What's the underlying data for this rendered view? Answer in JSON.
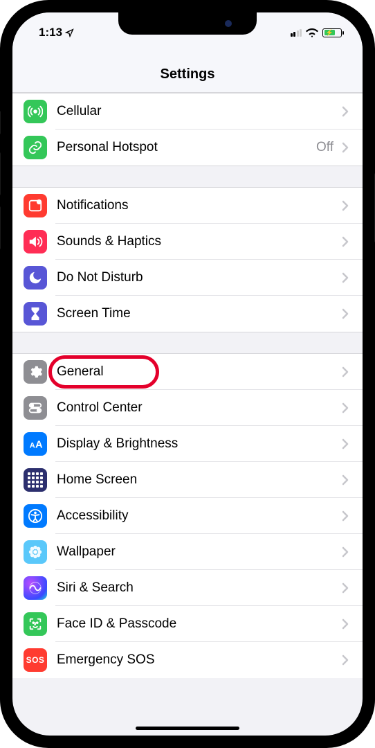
{
  "statusbar": {
    "time": "1:13"
  },
  "header": {
    "title": "Settings"
  },
  "groups": [
    {
      "rows": [
        {
          "id": "cellular",
          "label": "Cellular",
          "detail": "",
          "icon_bg": "bg-green",
          "icon_name": "antenna-icon"
        },
        {
          "id": "hotspot",
          "label": "Personal Hotspot",
          "detail": "Off",
          "icon_bg": "bg-green",
          "icon_name": "link-icon"
        }
      ]
    },
    {
      "rows": [
        {
          "id": "notifications",
          "label": "Notifications",
          "detail": "",
          "icon_bg": "bg-red",
          "icon_name": "notification-icon"
        },
        {
          "id": "sounds",
          "label": "Sounds & Haptics",
          "detail": "",
          "icon_bg": "bg-pink",
          "icon_name": "speaker-icon"
        },
        {
          "id": "dnd",
          "label": "Do Not Disturb",
          "detail": "",
          "icon_bg": "bg-indigo",
          "icon_name": "moon-icon"
        },
        {
          "id": "screentime",
          "label": "Screen Time",
          "detail": "",
          "icon_bg": "bg-indigo",
          "icon_name": "hourglass-icon"
        }
      ]
    },
    {
      "rows": [
        {
          "id": "general",
          "label": "General",
          "detail": "",
          "icon_bg": "bg-gray",
          "icon_name": "gear-icon",
          "highlighted": true
        },
        {
          "id": "controlcenter",
          "label": "Control Center",
          "detail": "",
          "icon_bg": "bg-gray",
          "icon_name": "switches-icon"
        },
        {
          "id": "display",
          "label": "Display & Brightness",
          "detail": "",
          "icon_bg": "bg-blue",
          "icon_name": "textsize-icon"
        },
        {
          "id": "homescreen",
          "label": "Home Screen",
          "detail": "",
          "icon_bg": "bg-homes",
          "icon_name": "grid-icon"
        },
        {
          "id": "accessibility",
          "label": "Accessibility",
          "detail": "",
          "icon_bg": "bg-blue",
          "icon_name": "accessibility-icon"
        },
        {
          "id": "wallpaper",
          "label": "Wallpaper",
          "detail": "",
          "icon_bg": "bg-cyan",
          "icon_name": "flower-icon"
        },
        {
          "id": "siri",
          "label": "Siri & Search",
          "detail": "",
          "icon_bg": "bg-grad",
          "icon_name": "siri-icon"
        },
        {
          "id": "faceid",
          "label": "Face ID & Passcode",
          "detail": "",
          "icon_bg": "bg-face",
          "icon_name": "faceid-icon"
        },
        {
          "id": "sos",
          "label": "Emergency SOS",
          "detail": "",
          "icon_bg": "bg-sos",
          "icon_name": "sos-icon",
          "icon_text": "SOS"
        }
      ]
    }
  ],
  "highlight": {
    "target": "general"
  }
}
